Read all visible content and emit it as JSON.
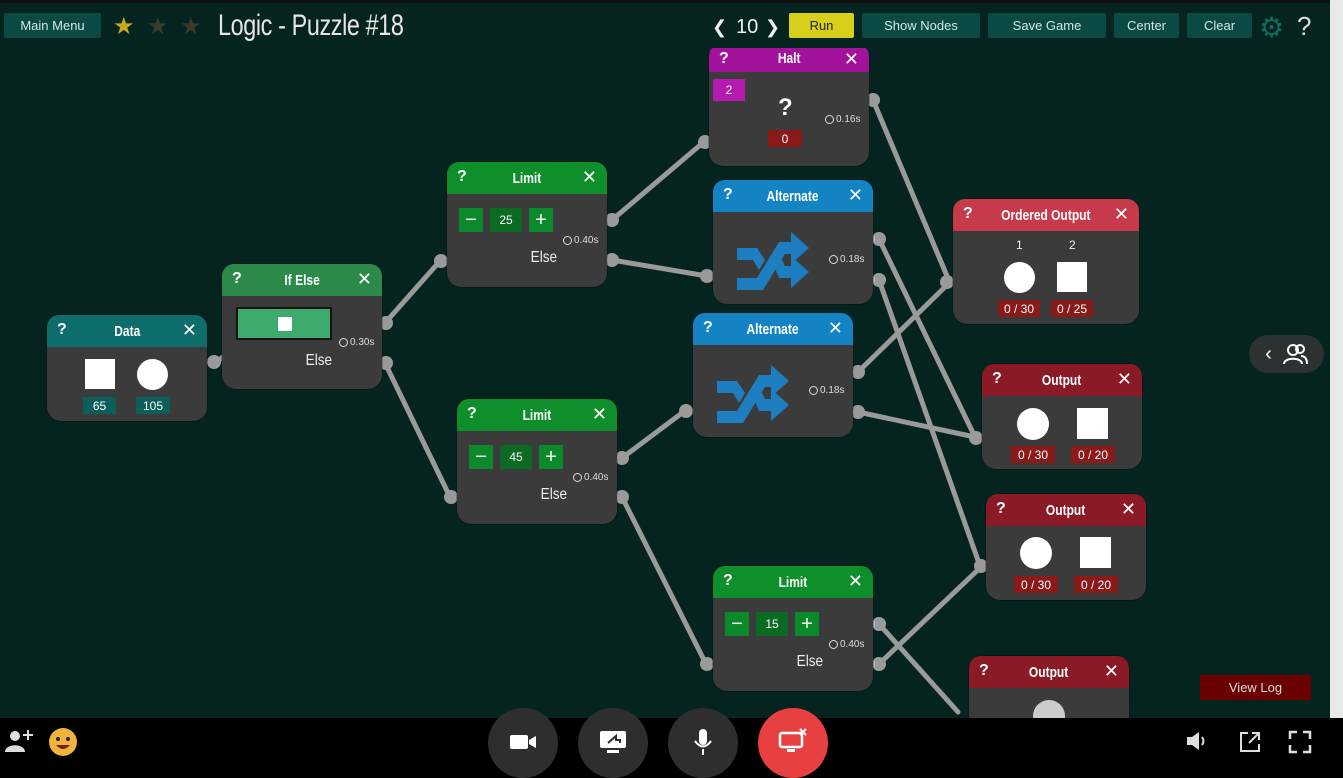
{
  "topbar": {
    "main_menu": "Main Menu",
    "title": "Logic - Puzzle #18",
    "speed_prev": "❮",
    "speed": "10",
    "speed_next": "❯",
    "run": "Run",
    "show_nodes": "Show Nodes",
    "save_game": "Save Game",
    "center": "Center",
    "clear": "Clear",
    "settings_icon": "⚙",
    "help": "?",
    "stars_earned": 1,
    "stars_total": 3
  },
  "nodes": {
    "data": {
      "title": "Data",
      "help": "?",
      "close": "✕",
      "count_square": "65",
      "count_circle": "105"
    },
    "ifelse": {
      "title": "If Else",
      "help": "?",
      "close": "✕",
      "time": "0.30s",
      "else_label": "Else"
    },
    "limit1": {
      "title": "Limit",
      "help": "?",
      "close": "✕",
      "minus": "−",
      "value": "25",
      "plus": "+",
      "time": "0.40s",
      "else_label": "Else"
    },
    "limit2": {
      "title": "Limit",
      "help": "?",
      "close": "✕",
      "minus": "−",
      "value": "45",
      "plus": "+",
      "time": "0.40s",
      "else_label": "Else"
    },
    "limit3": {
      "title": "Limit",
      "help": "?",
      "close": "✕",
      "minus": "−",
      "value": "15",
      "plus": "+",
      "time": "0.40s",
      "else_label": "Else"
    },
    "halt": {
      "title": "Halt",
      "help": "?",
      "close": "✕",
      "value": "2",
      "mystery": "?",
      "counter": "0",
      "time": "0.16s"
    },
    "alternate1": {
      "title": "Alternate",
      "help": "?",
      "close": "✕",
      "time": "0.18s"
    },
    "alternate2": {
      "title": "Alternate",
      "help": "?",
      "close": "✕",
      "time": "0.18s"
    },
    "ordered_output": {
      "title": "Ordered Output",
      "help": "?",
      "close": "✕",
      "order1": "1",
      "order2": "2",
      "count_circle": "0 / 30",
      "count_square": "0 / 25"
    },
    "output1": {
      "title": "Output",
      "help": "?",
      "close": "✕",
      "count_circle": "0 / 30",
      "count_square": "0 / 20"
    },
    "output2": {
      "title": "Output",
      "help": "?",
      "close": "✕",
      "count_circle": "0 / 30",
      "count_square": "0 / 20"
    },
    "output3": {
      "title": "Output",
      "help": "?",
      "close": "✕"
    }
  },
  "view_log": "View Log",
  "colors": {
    "board": "#06241f",
    "teal_header": "#0d6d6a",
    "green_header": "#0f8f2c",
    "magenta_header": "#a3129a",
    "blue_header": "#1483c4",
    "red_header": "#c63a4c",
    "dark_red_header": "#8a1a26",
    "node_body": "#3b3b3b",
    "run_button": "#d7cf1a"
  },
  "bottombar": {
    "icons": [
      "add-user-icon",
      "emoji-icon",
      "camera-icon",
      "share-screen-icon",
      "microphone-icon",
      "end-call-icon",
      "volume-icon",
      "popout-icon",
      "fullscreen-icon"
    ]
  }
}
